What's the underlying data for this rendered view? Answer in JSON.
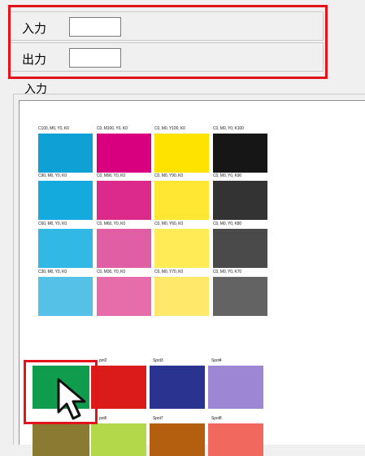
{
  "fields": {
    "input_label": "入力",
    "output_label": "出力",
    "input_value": "",
    "output_value": ""
  },
  "group_label": "入力",
  "swatches": [
    {
      "label": "C100, M0, Y0, K0",
      "color": "#0fa0d5"
    },
    {
      "label": "C0, M100, Y0, K0",
      "color": "#d8007f"
    },
    {
      "label": "C0, M0, Y100, K0",
      "color": "#ffe300"
    },
    {
      "label": "C0, M0, Y0, K100",
      "color": "#161616"
    },
    {
      "label": "C90, M0, Y0, K0",
      "color": "#15aade"
    },
    {
      "label": "C0, M90, Y0, K0",
      "color": "#db2a8c"
    },
    {
      "label": "C0, M0, Y90, K0",
      "color": "#ffe733"
    },
    {
      "label": "C0, M0, Y0, K90",
      "color": "#333333"
    },
    {
      "label": "C60, M0, Y0, K0",
      "color": "#32b8e5"
    },
    {
      "label": "C0, M60, Y0, K0",
      "color": "#e05ea4"
    },
    {
      "label": "C0, M0, Y60, K0",
      "color": "#ffeb55"
    },
    {
      "label": "C0, M0, Y0, K80",
      "color": "#4a4a4a"
    },
    {
      "label": "C30, M0, Y0, K0",
      "color": "#55c1e7"
    },
    {
      "label": "C0, M30, Y0, K0",
      "color": "#e66da9"
    },
    {
      "label": "C0, M0, Y70, K0",
      "color": "#ffe86a"
    },
    {
      "label": "C0, M0, Y0, K70",
      "color": "#636363"
    }
  ],
  "spots": [
    {
      "label": "",
      "color": "#0f9c4c"
    },
    {
      "label": "pot2",
      "color": "#db1a1a"
    },
    {
      "label": "Spot3",
      "color": "#2b3390"
    },
    {
      "label": "Spot4",
      "color": "#9d86d4"
    },
    {
      "label": "",
      "color": "#8a7a32"
    },
    {
      "label": "pot6",
      "color": "#b3d84a"
    },
    {
      "label": "Spot7",
      "color": "#b35f0f"
    },
    {
      "label": "Spot8",
      "color": "#f0685e"
    }
  ],
  "colors": {
    "highlight": "#e3121b"
  }
}
